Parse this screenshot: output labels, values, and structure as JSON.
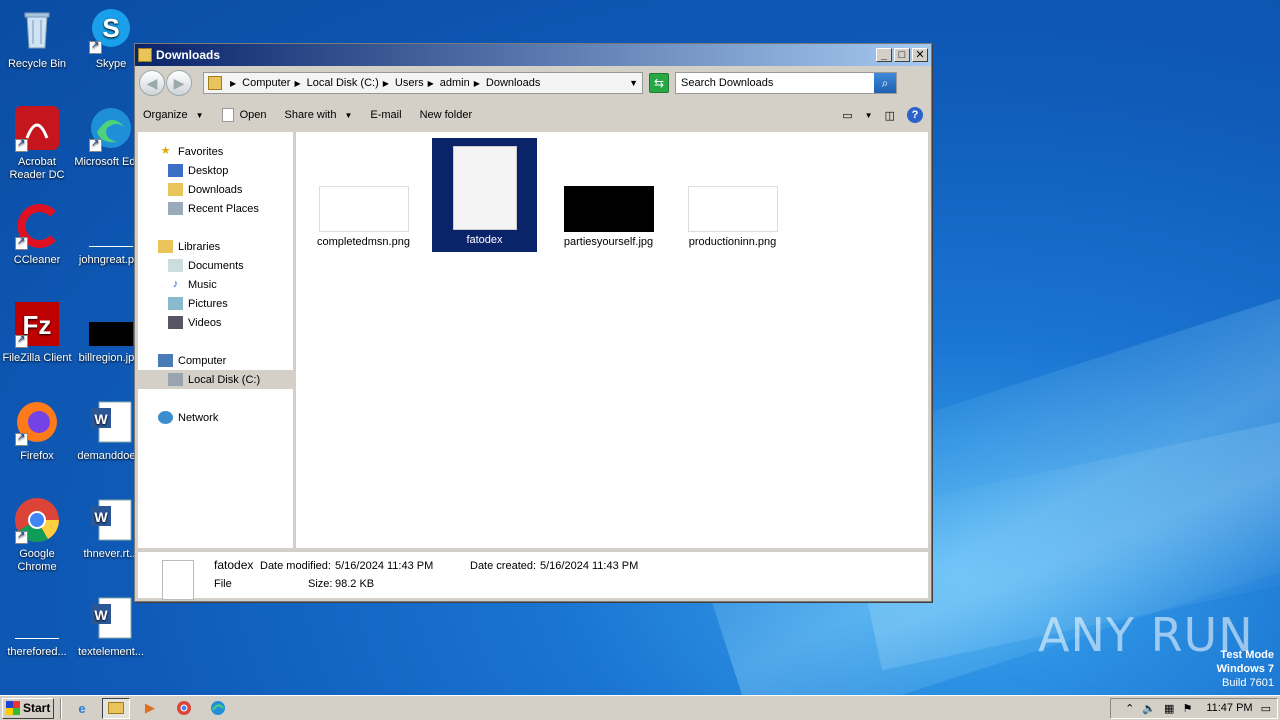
{
  "desktop": {
    "icons": [
      {
        "label": "Recycle Bin"
      },
      {
        "label": "Skype"
      },
      {
        "label": "Acrobat Reader DC"
      },
      {
        "label": "Microsoft Edge"
      },
      {
        "label": "CCleaner"
      },
      {
        "label": "johngreat.p..."
      },
      {
        "label": "FileZilla Client"
      },
      {
        "label": "billregion.jp..."
      },
      {
        "label": "Firefox"
      },
      {
        "label": "demanddoe..."
      },
      {
        "label": "Google Chrome"
      },
      {
        "label": "thnever.rt..."
      },
      {
        "label": "therefored..."
      },
      {
        "label": "textelement..."
      }
    ]
  },
  "window": {
    "title": "Downloads",
    "controls": {
      "minimize": "_",
      "maximize": "□",
      "close": "✕"
    },
    "address": {
      "crumbs": [
        "Computer",
        "Local Disk (C:)",
        "Users",
        "admin",
        "Downloads"
      ]
    },
    "search": {
      "placeholder": "Search Downloads"
    },
    "toolbar": {
      "organize": "Organize",
      "open": "Open",
      "share_with": "Share with",
      "email": "E-mail",
      "new_folder": "New folder"
    },
    "nav": {
      "favorites": "Favorites",
      "desktop": "Desktop",
      "downloads": "Downloads",
      "recent_places": "Recent Places",
      "libraries": "Libraries",
      "documents": "Documents",
      "music": "Music",
      "pictures": "Pictures",
      "videos": "Videos",
      "computer": "Computer",
      "local_disk": "Local Disk (C:)",
      "network": "Network"
    },
    "files": [
      {
        "name": "completedmsn.png"
      },
      {
        "name": "fatodex"
      },
      {
        "name": "partiesyourself.jpg"
      },
      {
        "name": "productioninn.png"
      }
    ],
    "details": {
      "name": "fatodex",
      "type": "File",
      "date_modified_label": "Date modified:",
      "date_modified": "5/16/2024 11:43 PM",
      "date_created_label": "Date created:",
      "date_created": "5/16/2024 11:43 PM",
      "size_label": "Size:",
      "size": "98.2 KB"
    }
  },
  "taskbar": {
    "start": "Start",
    "clock": "11:47 PM"
  },
  "watermark": {
    "brand": "ANY RUN",
    "line1": "Test Mode",
    "line2": "Windows 7",
    "line3": "Build 7601"
  }
}
